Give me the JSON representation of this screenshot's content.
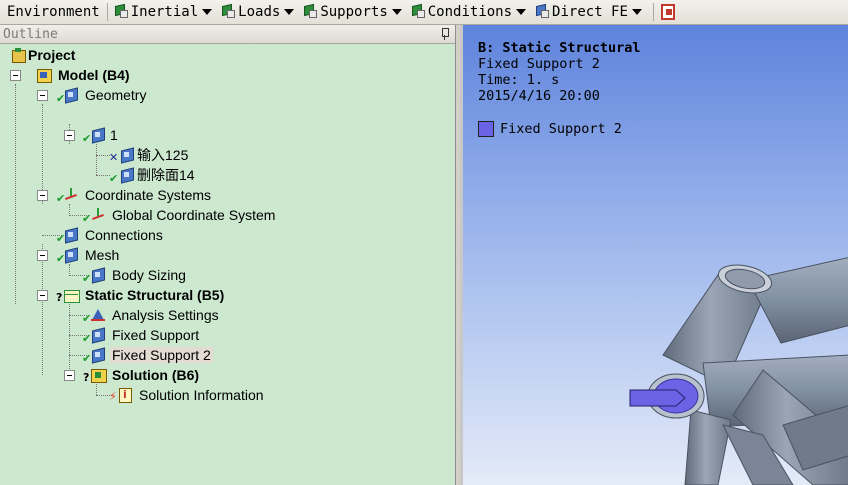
{
  "toolbar": {
    "items": [
      {
        "label": "Environment",
        "icon": "none",
        "dropdown": false
      },
      {
        "label": "Inertial",
        "icon": "inertial-icon",
        "dropdown": true
      },
      {
        "label": "Loads",
        "icon": "loads-icon",
        "dropdown": true
      },
      {
        "label": "Supports",
        "icon": "supports-icon",
        "dropdown": true
      },
      {
        "label": "Conditions",
        "icon": "conditions-icon",
        "dropdown": true
      },
      {
        "label": "Direct FE",
        "icon": "direct-fe-icon",
        "dropdown": true
      }
    ]
  },
  "outline": {
    "title": "Outline",
    "tree": {
      "project": "Project",
      "model": "Model (B4)",
      "geometry": "Geometry",
      "part1": "1",
      "body_input": "输入125",
      "body_delete": "删除面14",
      "coordinate_systems": "Coordinate Systems",
      "global_cs": "Global Coordinate System",
      "connections": "Connections",
      "mesh": "Mesh",
      "body_sizing": "Body Sizing",
      "static_structural": "Static Structural (B5)",
      "analysis_settings": "Analysis Settings",
      "fixed_support": "Fixed Support",
      "fixed_support_2": "Fixed Support 2",
      "solution": "Solution (B6)",
      "solution_information": "Solution Information"
    }
  },
  "viewport": {
    "title": "B: Static Structural",
    "subtitle": "Fixed Support 2",
    "time": "Time: 1. s",
    "date": "2015/4/16 20:00",
    "legend_label": "Fixed Support 2",
    "legend_color": "#6a63e6"
  },
  "colors": {
    "outline_bg": "#cce8cf",
    "viewport_top": "#5e83dc",
    "viewport_bottom": "#e4ebf8",
    "tube": "#8a96a6"
  }
}
